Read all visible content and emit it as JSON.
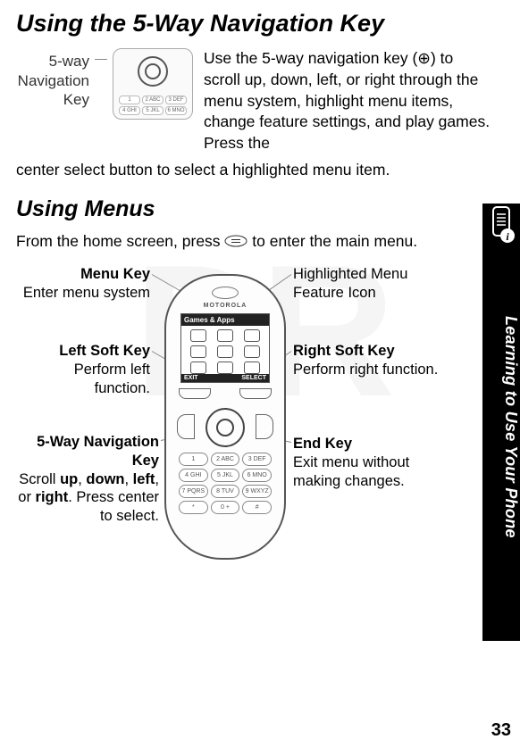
{
  "headings": {
    "h1": "Using the 5-Way Navigation Key",
    "h2": "Using Menus"
  },
  "intro": {
    "callout_label": "5-way Navigation Key",
    "paragraph_right": "Use the 5-way navigation key (⊕) to scroll up, down, left, or right through the menu system, highlight menu items, change feature settings, and play games. Press the",
    "paragraph_cont": "center select button to select a highlighted menu item."
  },
  "menus_line": {
    "before": "From the home screen, press ",
    "after": " to enter the main menu."
  },
  "phone": {
    "brand": "MOTOROLA",
    "screen_title": "Games & Apps",
    "soft_left": "EXIT",
    "soft_right": "SELECT",
    "keys": [
      "1",
      "2 ABC",
      "3 DEF",
      "4 GHI",
      "5 JKL",
      "6 MNO",
      "7 PQRS",
      "8 TUV",
      "9 WXYZ",
      "*",
      "0 +",
      "#"
    ]
  },
  "labels": {
    "menu_key_t": "Menu Key",
    "menu_key_d": "Enter menu system",
    "left_soft_t": "Left Soft Key",
    "left_soft_d": "Perform left function.",
    "fiveway_t": "5-Way Navigation Key",
    "fiveway_d": "Scroll up, down, left, or right. Press center to select.",
    "highlight_t": "Highlighted Menu Feature Icon",
    "right_soft_t": "Right Soft Key",
    "right_soft_d": "Perform right function.",
    "end_t": "End Key",
    "end_d": "Exit menu without making changes."
  },
  "side_tab_text": "Learning to Use Your Phone",
  "page_number": "33",
  "watermark": "DR"
}
